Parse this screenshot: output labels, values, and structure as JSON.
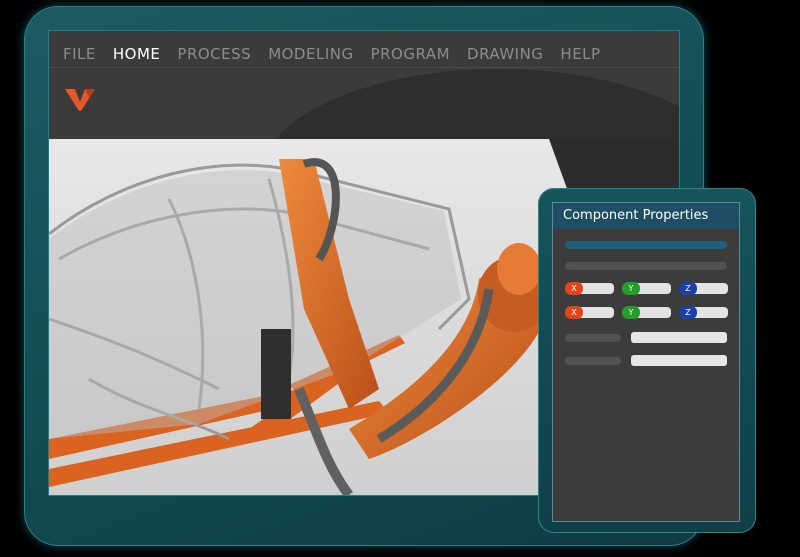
{
  "menu": {
    "items": [
      {
        "label": "FILE",
        "active": false
      },
      {
        "label": "HOME",
        "active": true
      },
      {
        "label": "PROCESS",
        "active": false
      },
      {
        "label": "MODELING",
        "active": false
      },
      {
        "label": "PROGRAM",
        "active": false
      },
      {
        "label": "DRAWING",
        "active": false
      },
      {
        "label": "HELP",
        "active": false
      }
    ]
  },
  "logo": {
    "icon": "v-logo-icon",
    "color": "#e8572a"
  },
  "panel": {
    "title": "Component Properties",
    "coord_rows": [
      {
        "x": "X",
        "y": "Y",
        "z": "Z"
      },
      {
        "x": "X",
        "y": "Y",
        "z": "Z"
      }
    ]
  },
  "colors": {
    "accent_teal": "#1a7f8a",
    "robot_orange": "#d9631f",
    "x_axis": "#e0451c",
    "y_axis": "#239c2a",
    "z_axis": "#1d3fa8"
  }
}
